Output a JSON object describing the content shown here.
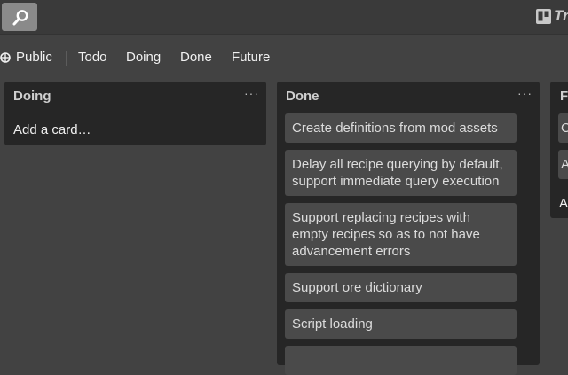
{
  "header": {
    "search_icon": "search-icon",
    "logo_icon": "trello-board-icon",
    "logo_text": "Trello"
  },
  "board_bar": {
    "visibility_icon": "globe-icon",
    "visibility_label": "Public",
    "tabs": [
      "Todo",
      "Doing",
      "Done",
      "Future"
    ]
  },
  "lists": [
    {
      "title": "Doing",
      "menu": "···",
      "cards": [],
      "add_card_label": "Add a card…"
    },
    {
      "title": "Done",
      "menu": "···",
      "cards": [
        "Create definitions from mod assets",
        "Delay all recipe querying by default, support immediate query execution",
        "Support replacing recipes with empty recipes so as to not have advancement errors",
        "Support ore dictionary",
        "Script loading",
        ""
      ]
    },
    {
      "title": "Future",
      "cards": [
        "C",
        "A"
      ],
      "add_card_label": "A"
    }
  ],
  "colors": {
    "background": "#424242",
    "list_background": "#262626",
    "card_background": "#4a4a4a",
    "search_button": "#8a8a8a"
  }
}
